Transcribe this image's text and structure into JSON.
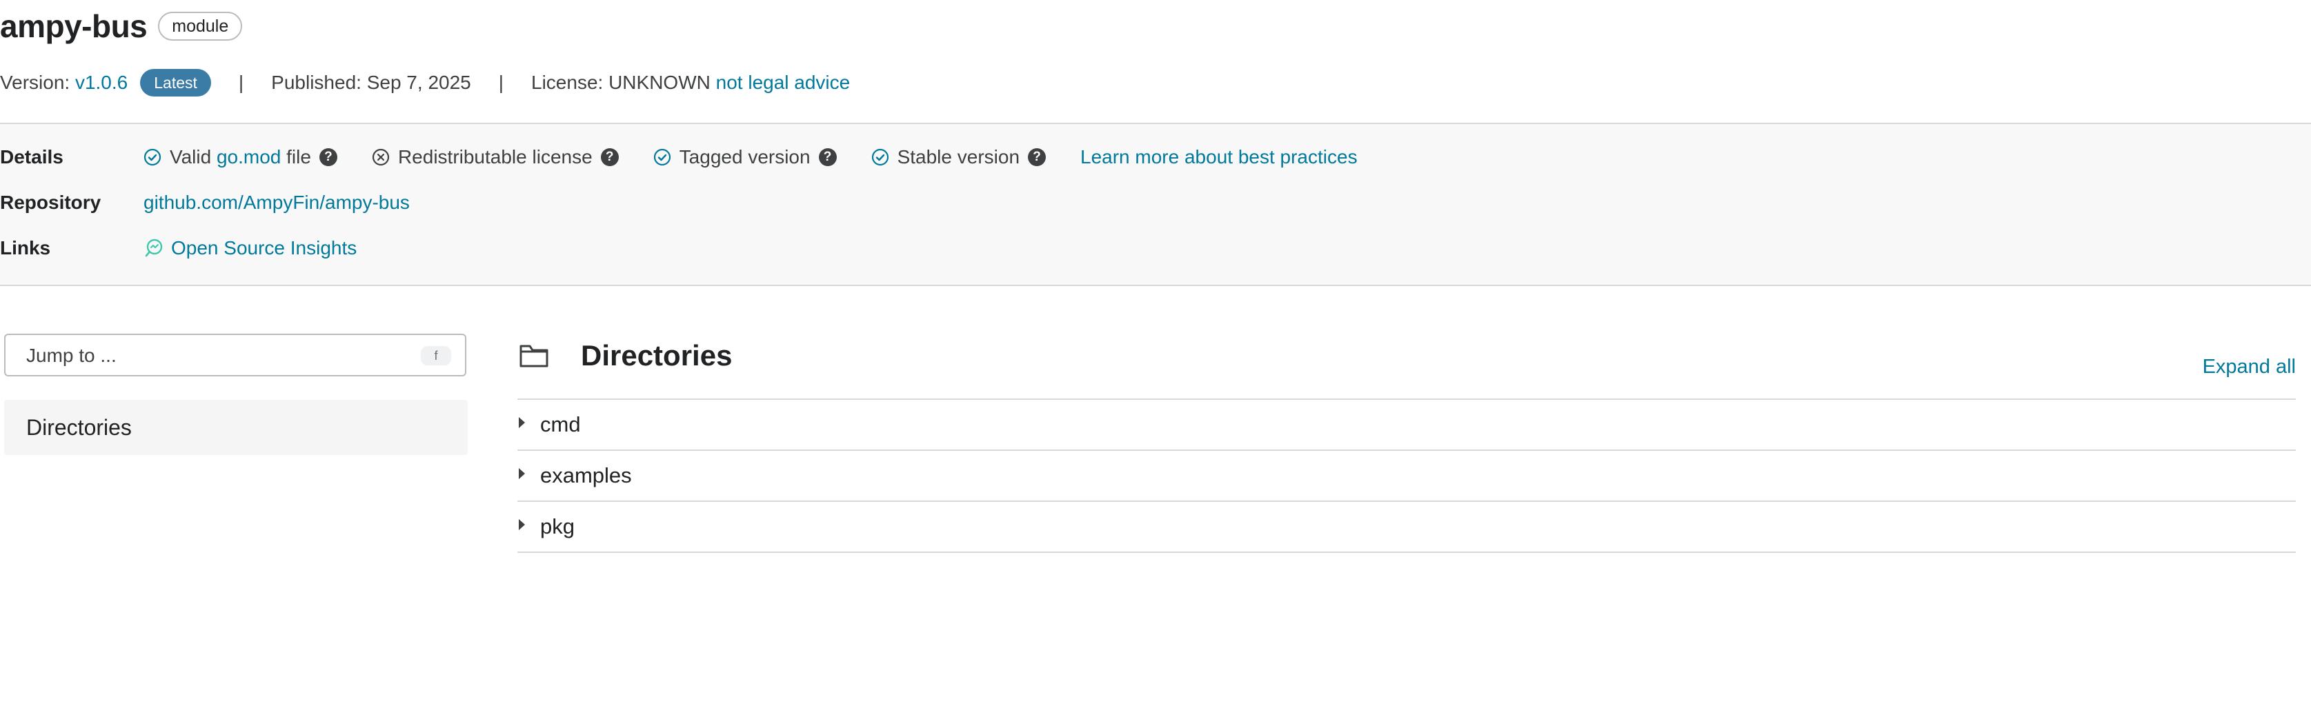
{
  "header": {
    "title": "ampy-bus",
    "badge": "module",
    "version_label": "Version:",
    "version_value": "v1.0.6",
    "latest_badge": "Latest",
    "separator": "|",
    "published": "Published: Sep 7, 2025",
    "license_label": "License: UNKNOWN",
    "license_note": "not legal advice"
  },
  "details": {
    "details_label": "Details",
    "checks": {
      "valid_prefix": "Valid",
      "valid_link": "go.mod",
      "valid_suffix": "file",
      "redistributable": "Redistributable license",
      "tagged": "Tagged version",
      "stable": "Stable version",
      "help_glyph": "?"
    },
    "learn_more": "Learn more about best practices",
    "repository_label": "Repository",
    "repository_link": "github.com/AmpyFin/ampy-bus",
    "links_label": "Links",
    "open_source_insights": "Open Source Insights"
  },
  "sidebar": {
    "jump_placeholder": "Jump to ...",
    "jump_shortcut": "f",
    "nav_directories": "Directories"
  },
  "main": {
    "section_title": "Directories",
    "expand_all": "Expand all",
    "directories": [
      "cmd",
      "examples",
      "pkg"
    ]
  },
  "colors": {
    "link": "#00799b",
    "latest_badge": "#3a7ca5",
    "check_ok": "#00799b",
    "check_fail": "#3e4042",
    "insights_icon": "#3ec7a8"
  },
  "icons": [
    "check-circle-icon",
    "x-circle-icon",
    "help-icon",
    "open-source-insights-icon",
    "folder-icon",
    "caret-right-icon"
  ]
}
